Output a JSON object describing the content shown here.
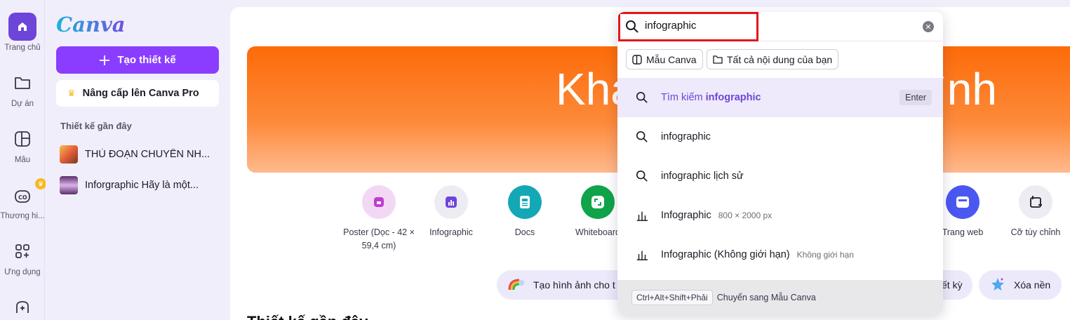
{
  "rail": {
    "items": [
      {
        "label": "Trang chủ",
        "icon": "home-icon"
      },
      {
        "label": "Dự án",
        "icon": "folder-icon"
      },
      {
        "label": "Mẫu",
        "icon": "template-icon"
      },
      {
        "label": "Thương hi...",
        "icon": "brand-icon"
      },
      {
        "label": "Ứng dụng",
        "icon": "apps-icon"
      }
    ]
  },
  "panel": {
    "logo": "Canva",
    "create_label": "Tạo thiết kế",
    "upgrade_label": "Nâng cấp lên Canva Pro",
    "recent_title": "Thiết kế gần đây",
    "recent": [
      {
        "title": "THỦ ĐOẠN CHUYỂN NH..."
      },
      {
        "title": "Inforgraphic Hãy là một..."
      }
    ]
  },
  "hero": {
    "text_left": "Kha",
    "text_right": "ình"
  },
  "tiles": [
    {
      "label": "Poster (Dọc - 42 × 59,4 cm)",
      "color": "#f3d8f6",
      "icon": "poster-icon"
    },
    {
      "label": "Infographic",
      "color": "#ececf2",
      "icon": "infographic-icon"
    },
    {
      "label": "Docs",
      "color": "#14a8b7",
      "icon": "docs-icon"
    },
    {
      "label": "Whiteboard",
      "color": "#0fa44a",
      "icon": "whiteboard-icon"
    },
    {
      "label": "Trang web",
      "color": "#4a57f0",
      "icon": "website-icon"
    },
    {
      "label": "Cỡ tùy chỉnh",
      "color": "#ececf2",
      "icon": "custom-size-icon"
    }
  ],
  "pills": [
    {
      "label": "Tạo hình ảnh cho t",
      "icon": "rainbow-icon"
    },
    {
      "label": "ết kỳ",
      "icon": ""
    },
    {
      "label": "Xóa nền",
      "icon": "sparkle-star-icon"
    }
  ],
  "heading_partial": "Thiết kế gần đây",
  "search": {
    "value": "infographic",
    "chips": [
      {
        "label": "Mẫu Canva",
        "icon": "template-icon"
      },
      {
        "label": "Tất cả nội dung của bạn",
        "icon": "folder-icon"
      }
    ],
    "suggestions": [
      {
        "prefix": "Tìm kiếm ",
        "bold": "infographic",
        "sub": "",
        "icon": "search-icon",
        "active": true
      },
      {
        "prefix": "infographic",
        "bold": "",
        "sub": "",
        "icon": "search-icon"
      },
      {
        "prefix": "infographic lịch sử",
        "bold": "",
        "sub": "",
        "icon": "search-icon"
      },
      {
        "prefix": "Infographic",
        "bold": "",
        "sub": "800 × 2000 px",
        "icon": "chart-bars-icon"
      },
      {
        "prefix": "Infographic (Không giới hạn)",
        "bold": "",
        "sub": "Không giới hạn",
        "icon": "chart-bars-icon"
      }
    ],
    "enter_label": "Enter",
    "footer_shortcut": "Ctrl+Alt+Shift+Phải",
    "footer_text": "Chuyển sang Mẫu Canva"
  },
  "colors": {
    "accent": "#8b3dff",
    "rail_active": "#6e45d9",
    "highlight_box": "#e3151c",
    "hero_orange": "#fd6b09"
  }
}
